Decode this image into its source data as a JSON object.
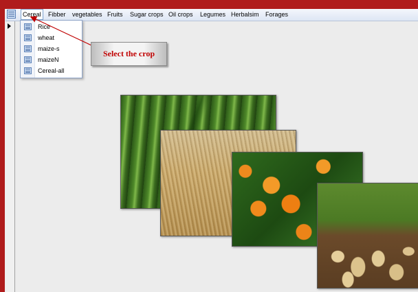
{
  "menubar": {
    "items": [
      "Cereal",
      "Fibber",
      "vegetables",
      "Fruits",
      "Sugar crops",
      "Oil crops",
      "Legumes",
      "Herbalsim",
      "Forages"
    ],
    "active": "Cereal"
  },
  "dropdown": {
    "items": [
      "Rice",
      "wheat",
      "maize-s",
      "maizeN",
      "Cereal-all"
    ]
  },
  "callout": {
    "text": "Select the crop"
  },
  "colors": {
    "frame": "#b01c1c",
    "callout_text": "#c00000",
    "arrow": "#c00000"
  },
  "photos": [
    "maize-photo",
    "wheat-photo",
    "orange-photo",
    "potato-photo"
  ]
}
